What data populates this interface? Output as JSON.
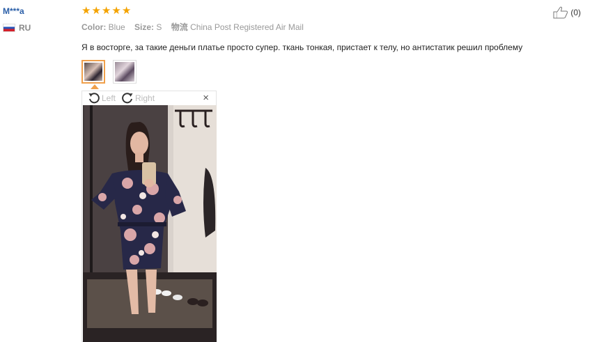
{
  "user": {
    "name": "M***a",
    "country": "RU"
  },
  "rating": {
    "stars": 5
  },
  "attributes": {
    "color_label": "Color:",
    "color_value": "Blue",
    "size_label": "Size:",
    "size_value": "S",
    "shipping_label": "物流",
    "shipping_value": "China Post Registered Air Mail"
  },
  "helpful": {
    "count_text": "(0)"
  },
  "review_text": "Я в восторге, за такие деньги платье просто супер. ткань тонкая, пристает к телу, но антистатик решил проблему",
  "viewer": {
    "rotate_left_label": "Left",
    "rotate_right_label": "Right",
    "close_glyph": "×"
  },
  "colors": {
    "star": "#f4a300",
    "user_link": "#2b5fa8",
    "active_thumb_border": "#f0a04b"
  }
}
